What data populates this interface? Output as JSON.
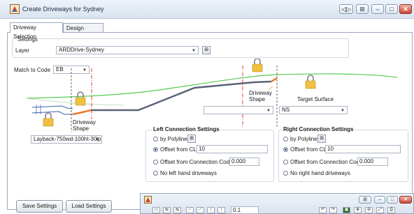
{
  "window": {
    "title": "Create Driveways for Sydney",
    "buttons": [
      "◁▷",
      "⊞",
      "–",
      "□",
      "✕"
    ]
  },
  "tabs": [
    {
      "label": "Driveway Selection",
      "active": true
    },
    {
      "label": "Design Settings",
      "active": false
    }
  ],
  "settings": {
    "group_label": "Settings",
    "layer_label": "Layer",
    "layer_value": "ARDDrive-Sydney"
  },
  "match_to_code": {
    "label": "Match to Code",
    "value": "EB"
  },
  "diagram": {
    "driveway_shape_left": "Driveway\nShape",
    "driveway_shape_right": "Driveway\nShape",
    "target_surface": "Target Surface",
    "shape_combo_value": "",
    "target_combo_value": "NS",
    "layback_combo_value": "Layback-750wd-100ht-30lp",
    "colors": {
      "profile_grey": "#5a6376",
      "shape_orange": "#f07820",
      "surface_green": "#58c850",
      "cl_red": "#dd2222",
      "lock_gold": "#f0c040"
    }
  },
  "left_connection": {
    "title": "Left Connection Settings",
    "by_polyline": "by Polyline",
    "offset_cl_label": "Offset from CL",
    "offset_cl_value": "10",
    "offset_code_label": "Offset from Connection Code",
    "offset_code_value": "0.000",
    "no_driveways": "No left hand driveways",
    "selected": "offset_cl"
  },
  "right_connection": {
    "title": "Right Connection Settings",
    "by_polyline": "by Polyline",
    "offset_cl_label": "Offset from CL",
    "offset_cl_value": "10",
    "offset_code_label": "Offset from Connection Code",
    "offset_code_value": "0.000",
    "no_driveways": "No right hand driveways",
    "selected": "offset_cl"
  },
  "footer": {
    "save_label": "Save Settings",
    "load_label": "Load Settings"
  },
  "sub_window": {
    "zoom_value": "0.1"
  }
}
